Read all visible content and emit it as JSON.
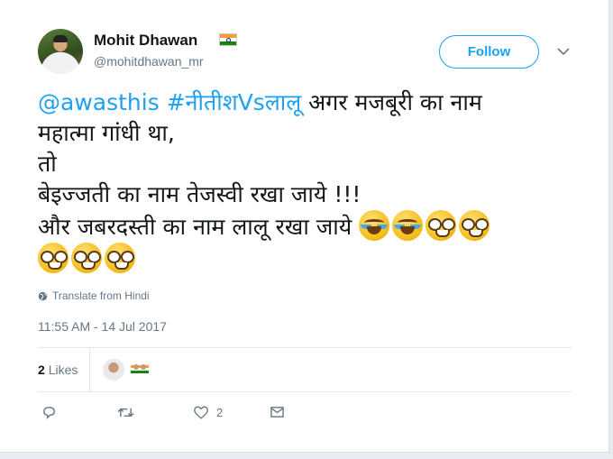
{
  "author": {
    "display_name": "Mohit Dhawan",
    "handle": "@mohitdhawan_mr",
    "flag_icon": "india-flag-icon"
  },
  "follow_button": {
    "label": "Follow"
  },
  "tweet": {
    "mention": "@awasthis",
    "hashtag": "#नीतीशVsलालू",
    "line1_rest": " अगर मजबूरी का नाम",
    "line2": "महात्मा गांधी था,",
    "line3": "तो",
    "line4": "बेइज्जती का नाम तेजस्वी रखा जाये !!!",
    "line5": "और जबरदस्ती का नाम लालू रखा जाये ",
    "emoji_line5": [
      "face-with-tears-of-joy",
      "face-with-tears-of-joy",
      "nerd-face",
      "nerd-face"
    ],
    "emoji_line6": [
      "nerd-face",
      "nerd-face",
      "nerd-face"
    ]
  },
  "translate_label": "Translate from Hindi",
  "timestamp": "11:55 AM - 14 Jul 2017",
  "likes": {
    "count": "2",
    "label": "Likes"
  },
  "actions": {
    "reply_icon": "reply-icon",
    "retweet_icon": "retweet-icon",
    "like_icon": "heart-icon",
    "like_count": "2",
    "dm_icon": "envelope-icon"
  },
  "colors": {
    "accent": "#1da1f2",
    "secondary_text": "#657786",
    "background": "#e6ecf0"
  }
}
